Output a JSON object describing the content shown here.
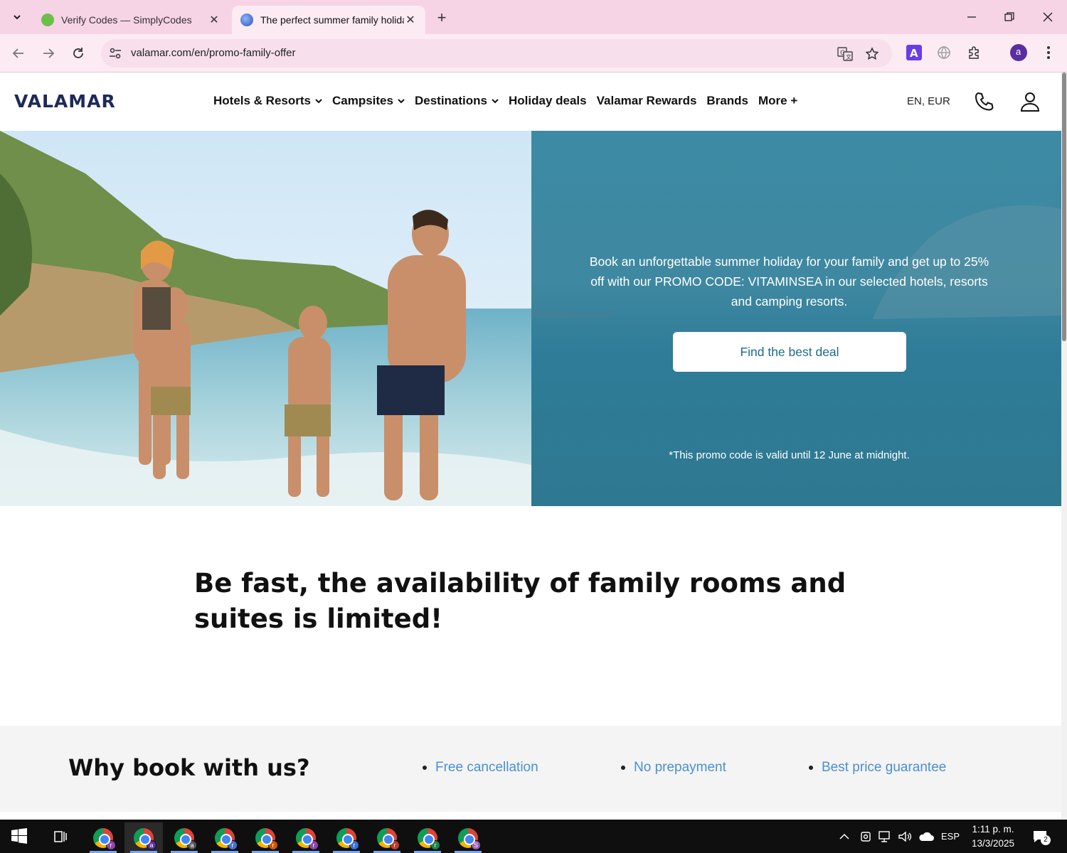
{
  "browser": {
    "tabs": [
      {
        "title": "Verify Codes — SimplyCodes",
        "active": false
      },
      {
        "title": "The perfect summer family holiday",
        "active": true
      }
    ],
    "url": "valamar.com/en/promo-family-offer",
    "profile_initial": "a"
  },
  "site": {
    "logo": "VALAMAR",
    "nav": [
      {
        "label": "Hotels & Resorts",
        "dropdown": true
      },
      {
        "label": "Campsites",
        "dropdown": true
      },
      {
        "label": "Destinations",
        "dropdown": true
      },
      {
        "label": "Holiday deals",
        "dropdown": false
      },
      {
        "label": "Valamar Rewards",
        "dropdown": false
      },
      {
        "label": "Brands",
        "dropdown": false
      },
      {
        "label": "More +",
        "dropdown": false
      }
    ],
    "lang_currency": "EN, EUR"
  },
  "hero": {
    "promo_text": "Book an unforgettable summer holiday for your family and get up to 25% off with our PROMO CODE: VITAMINSEA in our selected hotels, resorts and camping resorts.",
    "cta_label": "Find the best deal",
    "validity": "*This promo code is valid until 12 June at midnight."
  },
  "content": {
    "headline": "Be fast, the availability of family rooms and suites is limited!",
    "why_title": "Why book with us?",
    "benefits": [
      "Free cancellation",
      "No prepayment",
      "Best price guarantee"
    ]
  },
  "taskbar": {
    "app_badges": [
      "r",
      "a",
      "a",
      "r",
      "r",
      "r",
      "r",
      "r",
      "r",
      "S"
    ],
    "language": "ESP",
    "time": "1:11 p. m.",
    "date": "13/3/2025",
    "notifications": "2"
  },
  "colors": {
    "tabbar": "#f7d3e6",
    "brand_navy": "#1c2a5a",
    "hero_panel": "#3c8aa4",
    "cta_text": "#1d6b8a",
    "benefit_link": "#4a8fd1"
  }
}
